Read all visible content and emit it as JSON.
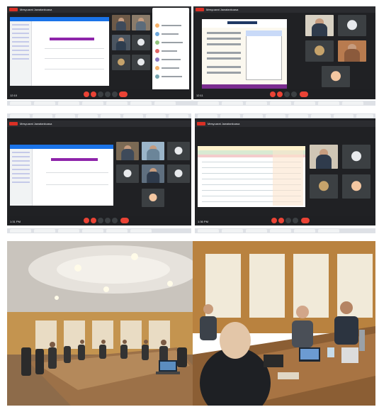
{
  "screens": {
    "top_left": {
      "time": "12:10",
      "title": "Mesyuarat Jawatankuasa"
    },
    "top_right": {
      "time": "12:11",
      "title": "Mesyuarat Jawatankuasa",
      "slide_heading": ""
    },
    "mid_left": {
      "time": "1:31 PM",
      "title": "Mesyuarat Jawatankuasa"
    },
    "mid_right": {
      "time": "1:36 PM",
      "title": "Mesyuarat Jawatankuasa"
    }
  },
  "photos": {
    "left": {
      "scene": "meeting-room-wide-view"
    },
    "right": {
      "scene": "meeting-table-close-view"
    }
  },
  "colors": {
    "meet_bg": "#202124",
    "end_call": "#ea4335",
    "accent_purple": "#8e24aa",
    "slide_green": "#d9ead3",
    "slide_yellow": "#fff2cc"
  }
}
